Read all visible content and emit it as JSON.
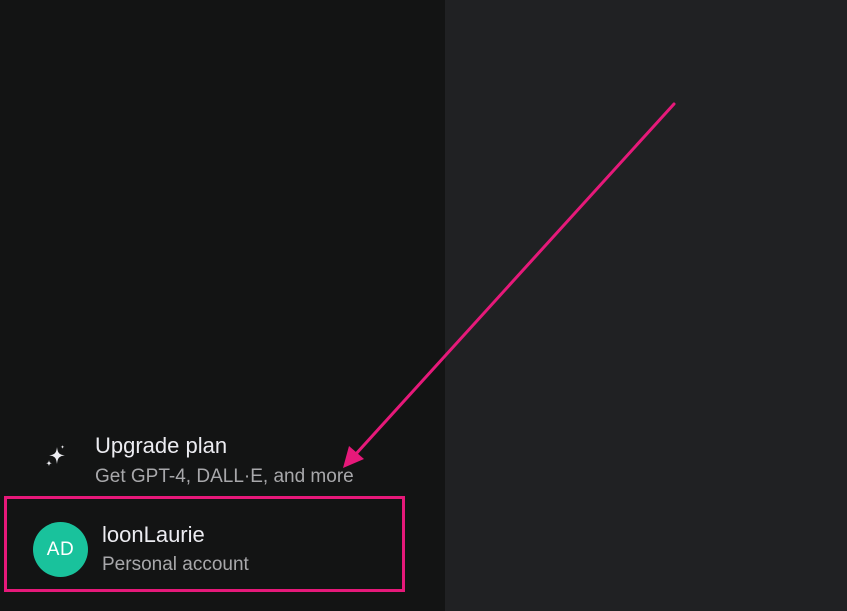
{
  "sidebar": {
    "upgrade": {
      "icon": "sparkle-icon",
      "title": "Upgrade plan",
      "subtitle": "Get GPT-4, DALL·E, and more"
    },
    "account": {
      "avatar_initials": "AD",
      "avatar_color": "#19c29c",
      "name": "loonLaurie",
      "type": "Personal account"
    }
  },
  "annotation": {
    "color": "#e6197a"
  }
}
